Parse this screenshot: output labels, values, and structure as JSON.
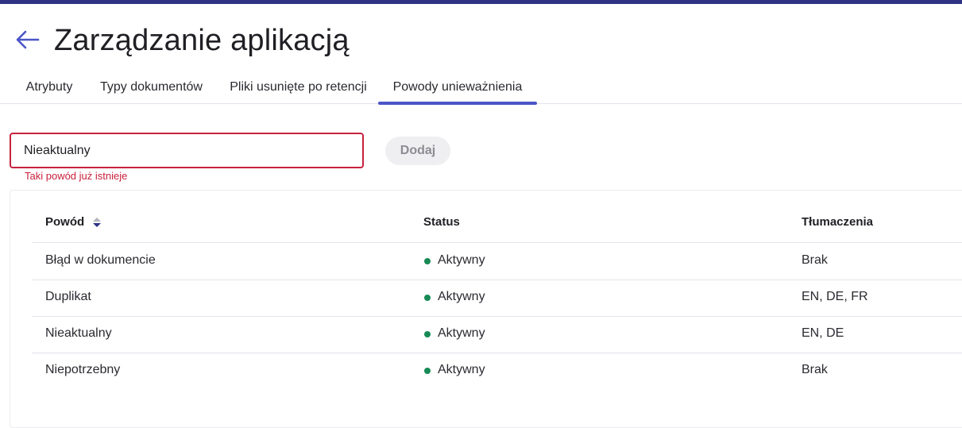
{
  "header": {
    "title": "Zarządzanie aplikacją"
  },
  "tabs": [
    {
      "label": "Atrybuty",
      "active": false
    },
    {
      "label": "Typy dokumentów",
      "active": false
    },
    {
      "label": "Pliki usunięte po retencji",
      "active": false
    },
    {
      "label": "Powody unieważnienia",
      "active": true
    }
  ],
  "form": {
    "input_value": "Nieaktualny",
    "error": "Taki powód już istnieje",
    "add_label": "Dodaj"
  },
  "table": {
    "headers": [
      "Powód",
      "Status",
      "Tłumaczenia"
    ],
    "rows": [
      {
        "reason": "Błąd w dokumencie",
        "status": "Aktywny",
        "translations": "Brak"
      },
      {
        "reason": "Duplikat",
        "status": "Aktywny",
        "translations": "EN, DE, FR"
      },
      {
        "reason": "Nieaktualny",
        "status": "Aktywny",
        "translations": "EN, DE"
      },
      {
        "reason": "Niepotrzebny",
        "status": "Aktywny",
        "translations": "Brak"
      }
    ]
  },
  "colors": {
    "brand_bar": "#2e3383",
    "accent": "#4a55c7",
    "error": "#c8213e",
    "status_active": "#178a55"
  },
  "icons": {
    "back": "arrow-left-icon",
    "sort": "sort-icon",
    "status": "status-dot-icon"
  }
}
